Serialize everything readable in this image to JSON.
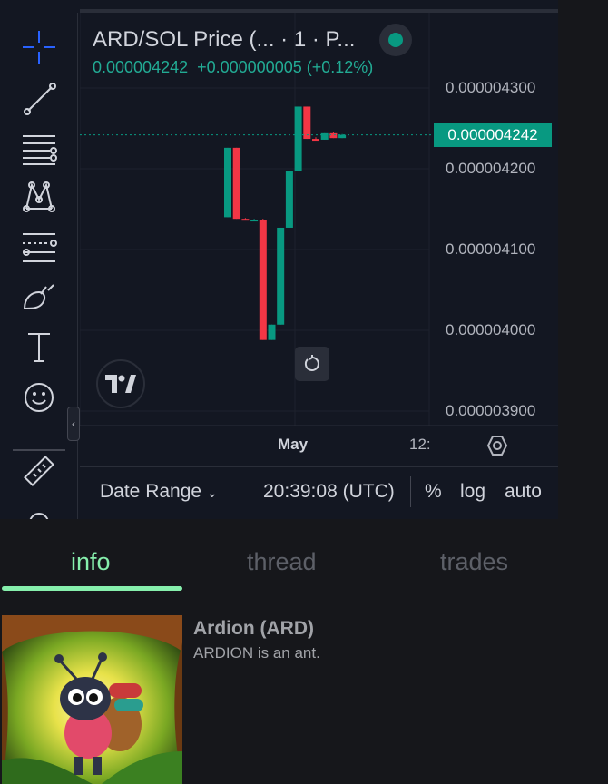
{
  "chart": {
    "legend_title": "ARD/SOL Price (... · 1 · P...",
    "last_value": "0.000004242",
    "change": "+0.000000005 (+0.12%)",
    "current_price_label": "0.000004242",
    "price_scale": [
      "0.000004300",
      "0.000004200",
      "0.000004100",
      "0.000004000",
      "0.000003900"
    ],
    "time_labels": [
      "May",
      "12:"
    ],
    "colors": {
      "up": "#089981",
      "down": "#f23645",
      "background": "#131722"
    },
    "candles": [
      {
        "o": 4.14e-06,
        "h": 4.226e-06,
        "l": 4.14e-06,
        "c": 4.226e-06
      },
      {
        "o": 4.226e-06,
        "h": 4.226e-06,
        "l": 4.138e-06,
        "c": 4.138e-06
      },
      {
        "o": 4.138e-06,
        "h": 4.139e-06,
        "l": 4.136e-06,
        "c": 4.137e-06
      },
      {
        "o": 4.137e-06,
        "h": 4.138e-06,
        "l": 4.136e-06,
        "c": 4.137e-06
      },
      {
        "o": 4.137e-06,
        "h": 4.138e-06,
        "l": 3.988e-06,
        "c": 3.988e-06
      },
      {
        "o": 3.988e-06,
        "h": 4.007e-06,
        "l": 3.988e-06,
        "c": 4.007e-06
      },
      {
        "o": 4.007e-06,
        "h": 4.127e-06,
        "l": 4.007e-06,
        "c": 4.127e-06
      },
      {
        "o": 4.127e-06,
        "h": 4.197e-06,
        "l": 4.127e-06,
        "c": 4.197e-06
      },
      {
        "o": 4.197e-06,
        "h": 4.277e-06,
        "l": 4.197e-06,
        "c": 4.277e-06
      },
      {
        "o": 4.277e-06,
        "h": 4.277e-06,
        "l": 4.237e-06,
        "c": 4.237e-06
      },
      {
        "o": 4.237e-06,
        "h": 4.239e-06,
        "l": 4.235e-06,
        "c": 4.236e-06
      },
      {
        "o": 4.236e-06,
        "h": 4.244e-06,
        "l": 4.236e-06,
        "c": 4.244e-06
      },
      {
        "o": 4.244e-06,
        "h": 4.245e-06,
        "l": 4.238e-06,
        "c": 4.238e-06
      },
      {
        "o": 4.238e-06,
        "h": 4.243e-06,
        "l": 4.238e-06,
        "c": 4.242e-06
      }
    ]
  },
  "bottom_bar": {
    "date_range": "Date Range",
    "clock": "20:39:08 (UTC)",
    "percent": "%",
    "log": "log",
    "auto": "auto"
  },
  "tabs": [
    "info",
    "thread",
    "trades"
  ],
  "coin": {
    "name": "Ardion (ARD)",
    "description": "ARDION is an ant."
  },
  "toolbar": {
    "tools": [
      "crosshair-icon",
      "trend-line-icon",
      "fib-retracement-icon",
      "pattern-icon",
      "prediction-icon",
      "brush-icon",
      "text-icon",
      "emoji-icon",
      "ruler-icon"
    ]
  }
}
